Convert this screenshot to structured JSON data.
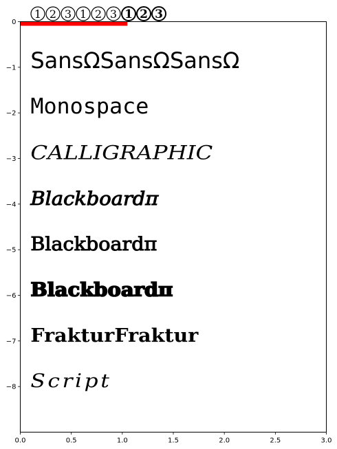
{
  "chart_data": {
    "type": "text",
    "title": "",
    "xlabel": "",
    "ylabel": "",
    "xlim": [
      0,
      3
    ],
    "ylim": [
      -9,
      0
    ],
    "grid": false,
    "xticks": [
      0.0,
      0.5,
      1.0,
      1.5,
      2.0,
      2.5,
      3.0
    ],
    "xtick_labels": [
      "0.0",
      "0.5",
      "1.0",
      "1.5",
      "2.0",
      "2.5",
      "3.0"
    ],
    "yticks": [
      0,
      -1,
      -2,
      -3,
      -4,
      -5,
      -6,
      -7,
      -8
    ],
    "ytick_labels": [
      "0",
      "−1",
      "−2",
      "−3",
      "−4",
      "−5",
      "−6",
      "−7",
      "−8"
    ],
    "header_circled_numbers": [
      {
        "text": "1",
        "style": "normal"
      },
      {
        "text": "2",
        "style": "normal"
      },
      {
        "text": "3",
        "style": "normal"
      },
      {
        "text": "1",
        "style": "normal"
      },
      {
        "text": "2",
        "style": "normal"
      },
      {
        "text": "3",
        "style": "normal"
      },
      {
        "text": "1",
        "style": "bold"
      },
      {
        "text": "2",
        "style": "bold"
      },
      {
        "text": "3",
        "style": "bold"
      }
    ],
    "red_bar": {
      "x_start": 0.0,
      "x_end": 1.05,
      "y": 0.0,
      "color": "#ff0000"
    },
    "samples": [
      {
        "text": "SansΩSansΩSansΩ",
        "x": 0.1,
        "y": -0.85,
        "style": "sans"
      },
      {
        "text": "Monospace",
        "x": 0.1,
        "y": -1.85,
        "style": "mono"
      },
      {
        "text": "CALLIGRAPHIC",
        "x": 0.1,
        "y": -2.85,
        "style": "calligraphic"
      },
      {
        "text": "Blackboardπ",
        "x": 0.1,
        "y": -3.85,
        "style": "blackboard-italic"
      },
      {
        "text": "Blackboardπ",
        "x": 0.1,
        "y": -4.85,
        "style": "blackboard"
      },
      {
        "text": "Blackboardπ",
        "x": 0.1,
        "y": -5.85,
        "style": "blackboard-bold"
      },
      {
        "text": "FrakturFraktur",
        "x": 0.1,
        "y": -6.85,
        "style": "fraktur"
      },
      {
        "text": "Script",
        "x": 0.1,
        "y": -7.85,
        "style": "script"
      }
    ]
  }
}
